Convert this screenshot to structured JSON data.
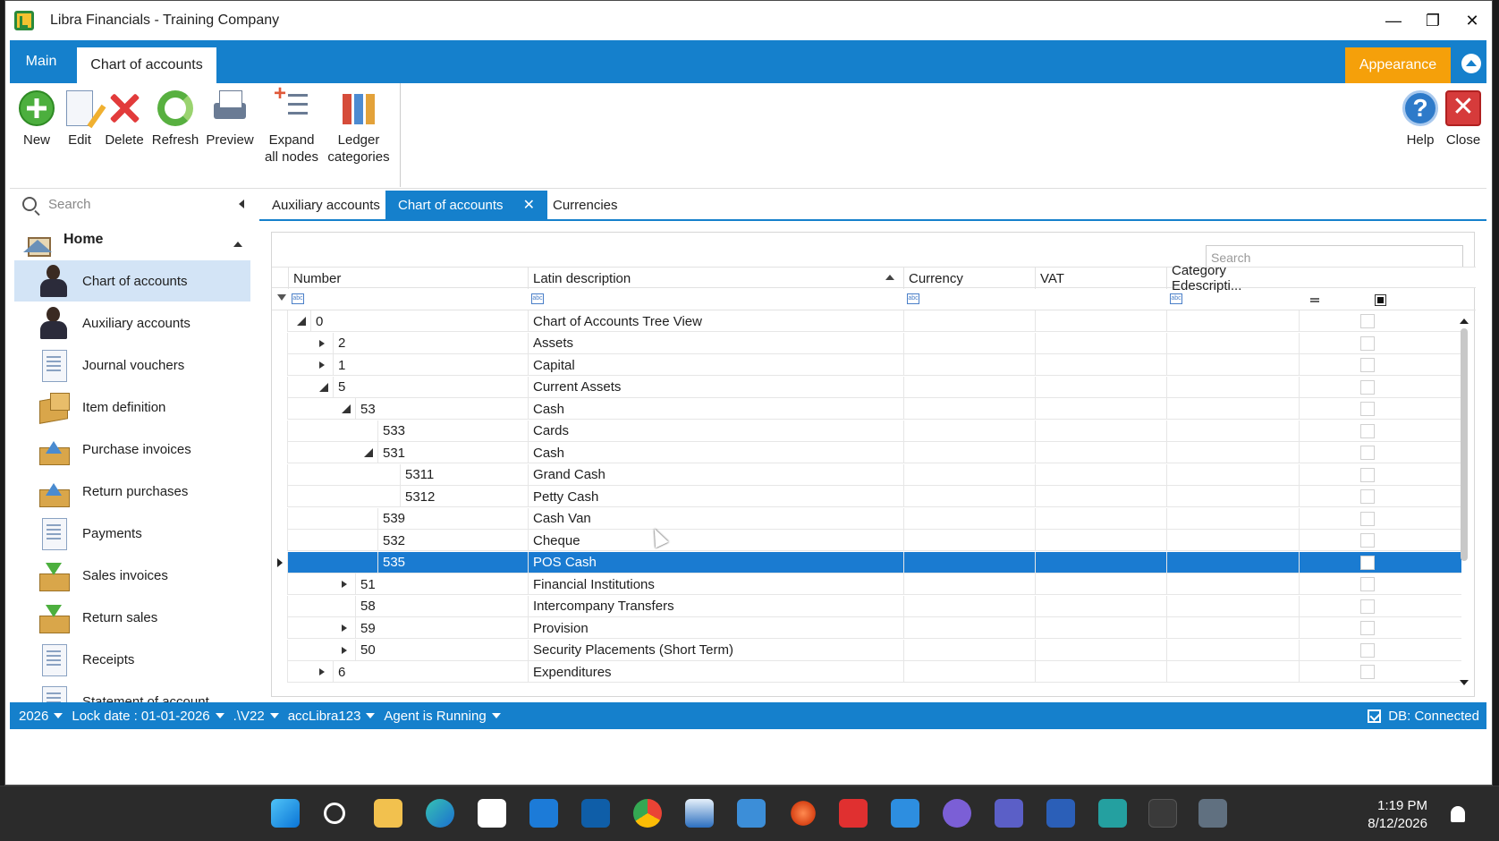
{
  "window": {
    "title": "Libra Financials - Training Company"
  },
  "ribbon": {
    "tab_main": "Main",
    "tab_active": "Chart of accounts",
    "appearance": "Appearance",
    "tools": {
      "new": "New",
      "edit": "Edit",
      "delete": "Delete",
      "refresh": "Refresh",
      "preview": "Preview",
      "expand_1": "Expand",
      "expand_2": "all nodes",
      "ledger_1": "Ledger",
      "ledger_2": "categories",
      "help": "Help",
      "close": "Close"
    }
  },
  "sidebar": {
    "search_placeholder": "Search",
    "home": "Home",
    "items": [
      {
        "label": "Chart of accounts",
        "icon": "person-icon"
      },
      {
        "label": "Auxiliary accounts",
        "icon": "person-icon"
      },
      {
        "label": "Journal vouchers",
        "icon": "document-icon"
      },
      {
        "label": "Item definition",
        "icon": "boxes-icon"
      },
      {
        "label": "Purchase invoices",
        "icon": "tray-upload-icon"
      },
      {
        "label": "Return purchases",
        "icon": "tray-upload-icon"
      },
      {
        "label": "Payments",
        "icon": "document-icon"
      },
      {
        "label": "Sales invoices",
        "icon": "tray-download-icon"
      },
      {
        "label": "Return sales",
        "icon": "tray-download-icon"
      },
      {
        "label": "Receipts",
        "icon": "document-icon"
      },
      {
        "label": "Statement of account",
        "icon": "document-icon"
      }
    ]
  },
  "tabs": {
    "auxiliary": "Auxiliary accounts",
    "coa": "Chart of accounts",
    "currencies": "Currencies"
  },
  "grid": {
    "search_placeholder": "Search",
    "columns": {
      "number": "Number",
      "description": "Latin description",
      "currency": "Currency",
      "vat": "VAT",
      "category": "Category Edescripti..."
    },
    "rows": [
      {
        "number": "0",
        "description": "Chart of Accounts Tree View"
      },
      {
        "number": "2",
        "description": "Assets"
      },
      {
        "number": "1",
        "description": "Capital"
      },
      {
        "number": "5",
        "description": "Current Assets"
      },
      {
        "number": "53",
        "description": "Cash"
      },
      {
        "number": "533",
        "description": "Cards"
      },
      {
        "number": "531",
        "description": "Cash"
      },
      {
        "number": "5311",
        "description": "Grand Cash"
      },
      {
        "number": "5312",
        "description": "Petty Cash"
      },
      {
        "number": "539",
        "description": "Cash Van"
      },
      {
        "number": "532",
        "description": "Cheque"
      },
      {
        "number": "535",
        "description": "POS Cash"
      },
      {
        "number": "51",
        "description": "Financial Institutions"
      },
      {
        "number": "58",
        "description": "Intercompany Transfers"
      },
      {
        "number": "59",
        "description": "Provision"
      },
      {
        "number": "50",
        "description": "Security Placements (Short Term)"
      },
      {
        "number": "6",
        "description": "Expenditures"
      }
    ]
  },
  "status": {
    "year": "2026",
    "lock": "Lock date : 01-01-2026",
    "server": ".\\V22",
    "db": "accLibra123",
    "agent": "Agent is Running",
    "connection": "DB: Connected"
  },
  "taskbar": {
    "time": "1:19 PM",
    "date": "8/12/2026"
  },
  "colors": {
    "accent": "#1580cc",
    "appearance": "#f5a00a",
    "selected_row": "#1a7bd1"
  }
}
